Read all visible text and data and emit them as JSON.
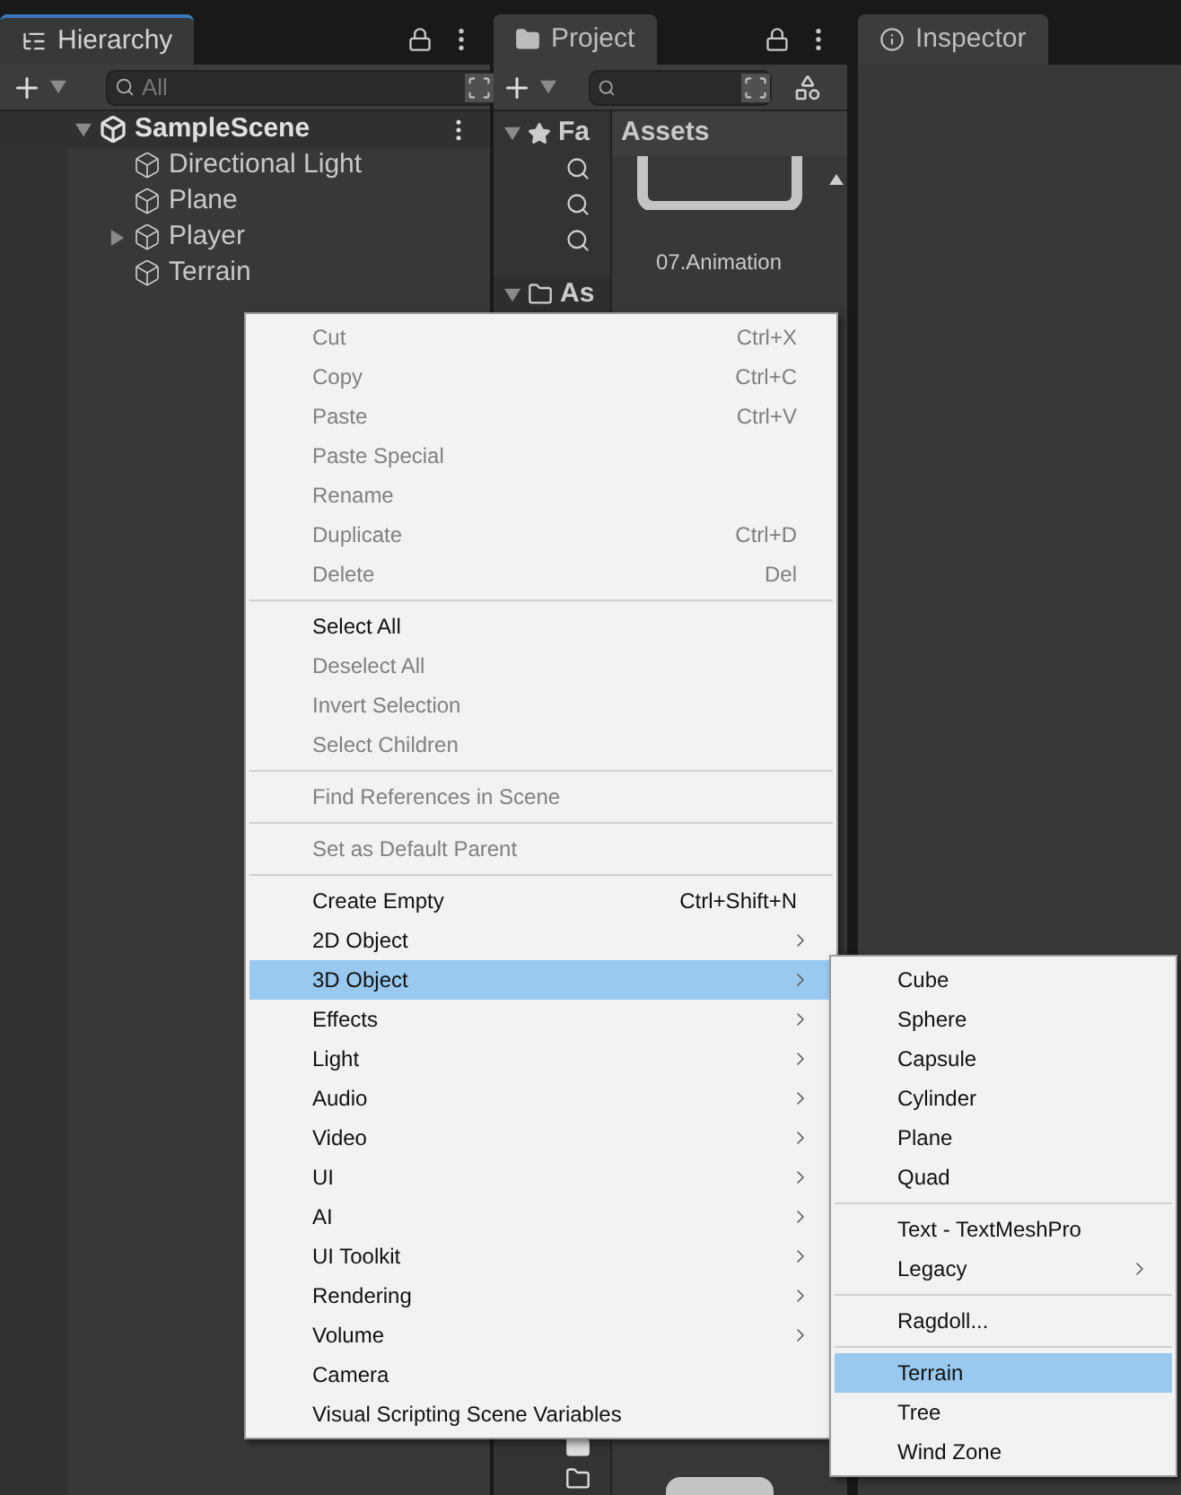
{
  "hierarchy": {
    "tab": "Hierarchy",
    "selected": true,
    "search_placeholder": "All",
    "scene": "SampleScene",
    "items": [
      {
        "label": "Directional Light",
        "has_children": false
      },
      {
        "label": "Plane",
        "has_children": false
      },
      {
        "label": "Player",
        "has_children": true
      },
      {
        "label": "Terrain",
        "has_children": false
      }
    ]
  },
  "project": {
    "tab": "Project",
    "selected": false,
    "favorites": "Fa",
    "assets_root": "As",
    "header": "Assets",
    "asset": "07.Animation"
  },
  "inspector": {
    "tab": "Inspector",
    "selected": false
  },
  "context_menu": {
    "groups": [
      [
        {
          "label": "Cut",
          "shortcut": "Ctrl+X",
          "disabled": true,
          "submenu": false,
          "selected": false
        },
        {
          "label": "Copy",
          "shortcut": "Ctrl+C",
          "disabled": true,
          "submenu": false,
          "selected": false
        },
        {
          "label": "Paste",
          "shortcut": "Ctrl+V",
          "disabled": true,
          "submenu": false,
          "selected": false
        },
        {
          "label": "Paste Special",
          "disabled": true,
          "submenu": false,
          "selected": false
        },
        {
          "label": "Rename",
          "disabled": true,
          "submenu": false,
          "selected": false
        },
        {
          "label": "Duplicate",
          "shortcut": "Ctrl+D",
          "disabled": true,
          "submenu": false,
          "selected": false
        },
        {
          "label": "Delete",
          "shortcut": "Del",
          "disabled": true,
          "submenu": false,
          "selected": false
        }
      ],
      [
        {
          "label": "Select All",
          "disabled": false,
          "submenu": false,
          "selected": false
        },
        {
          "label": "Deselect All",
          "disabled": true,
          "submenu": false,
          "selected": false
        },
        {
          "label": "Invert Selection",
          "disabled": true,
          "submenu": false,
          "selected": false
        },
        {
          "label": "Select Children",
          "disabled": true,
          "submenu": false,
          "selected": false
        }
      ],
      [
        {
          "label": "Find References in Scene",
          "disabled": true,
          "submenu": false,
          "selected": false
        }
      ],
      [
        {
          "label": "Set as Default Parent",
          "disabled": true,
          "submenu": false,
          "selected": false
        }
      ],
      [
        {
          "label": "Create Empty",
          "shortcut": "Ctrl+Shift+N",
          "disabled": false,
          "submenu": false,
          "selected": false
        },
        {
          "label": "2D Object",
          "disabled": false,
          "submenu": true,
          "selected": false
        },
        {
          "label": "3D Object",
          "disabled": false,
          "submenu": true,
          "selected": true
        },
        {
          "label": "Effects",
          "disabled": false,
          "submenu": true,
          "selected": false
        },
        {
          "label": "Light",
          "disabled": false,
          "submenu": true,
          "selected": false
        },
        {
          "label": "Audio",
          "disabled": false,
          "submenu": true,
          "selected": false
        },
        {
          "label": "Video",
          "disabled": false,
          "submenu": true,
          "selected": false
        },
        {
          "label": "UI",
          "disabled": false,
          "submenu": true,
          "selected": false
        },
        {
          "label": "AI",
          "disabled": false,
          "submenu": true,
          "selected": false
        },
        {
          "label": "UI Toolkit",
          "disabled": false,
          "submenu": true,
          "selected": false
        },
        {
          "label": "Rendering",
          "disabled": false,
          "submenu": true,
          "selected": false
        },
        {
          "label": "Volume",
          "disabled": false,
          "submenu": true,
          "selected": false
        },
        {
          "label": "Camera",
          "disabled": false,
          "submenu": false,
          "selected": false
        },
        {
          "label": "Visual Scripting Scene Variables",
          "disabled": false,
          "submenu": false,
          "selected": false
        }
      ]
    ]
  },
  "submenu": {
    "groups": [
      [
        {
          "label": "Cube",
          "submenu": false,
          "selected": false
        },
        {
          "label": "Sphere",
          "submenu": false,
          "selected": false
        },
        {
          "label": "Capsule",
          "submenu": false,
          "selected": false
        },
        {
          "label": "Cylinder",
          "submenu": false,
          "selected": false
        },
        {
          "label": "Plane",
          "submenu": false,
          "selected": false
        },
        {
          "label": "Quad",
          "submenu": false,
          "selected": false
        }
      ],
      [
        {
          "label": "Text - TextMeshPro",
          "submenu": false,
          "selected": false
        },
        {
          "label": "Legacy",
          "submenu": true,
          "selected": false
        }
      ],
      [
        {
          "label": "Ragdoll...",
          "submenu": false,
          "selected": false
        }
      ],
      [
        {
          "label": "Terrain",
          "submenu": false,
          "selected": true
        },
        {
          "label": "Tree",
          "submenu": false,
          "selected": false
        },
        {
          "label": "Wind Zone",
          "submenu": false,
          "selected": false
        }
      ]
    ]
  }
}
